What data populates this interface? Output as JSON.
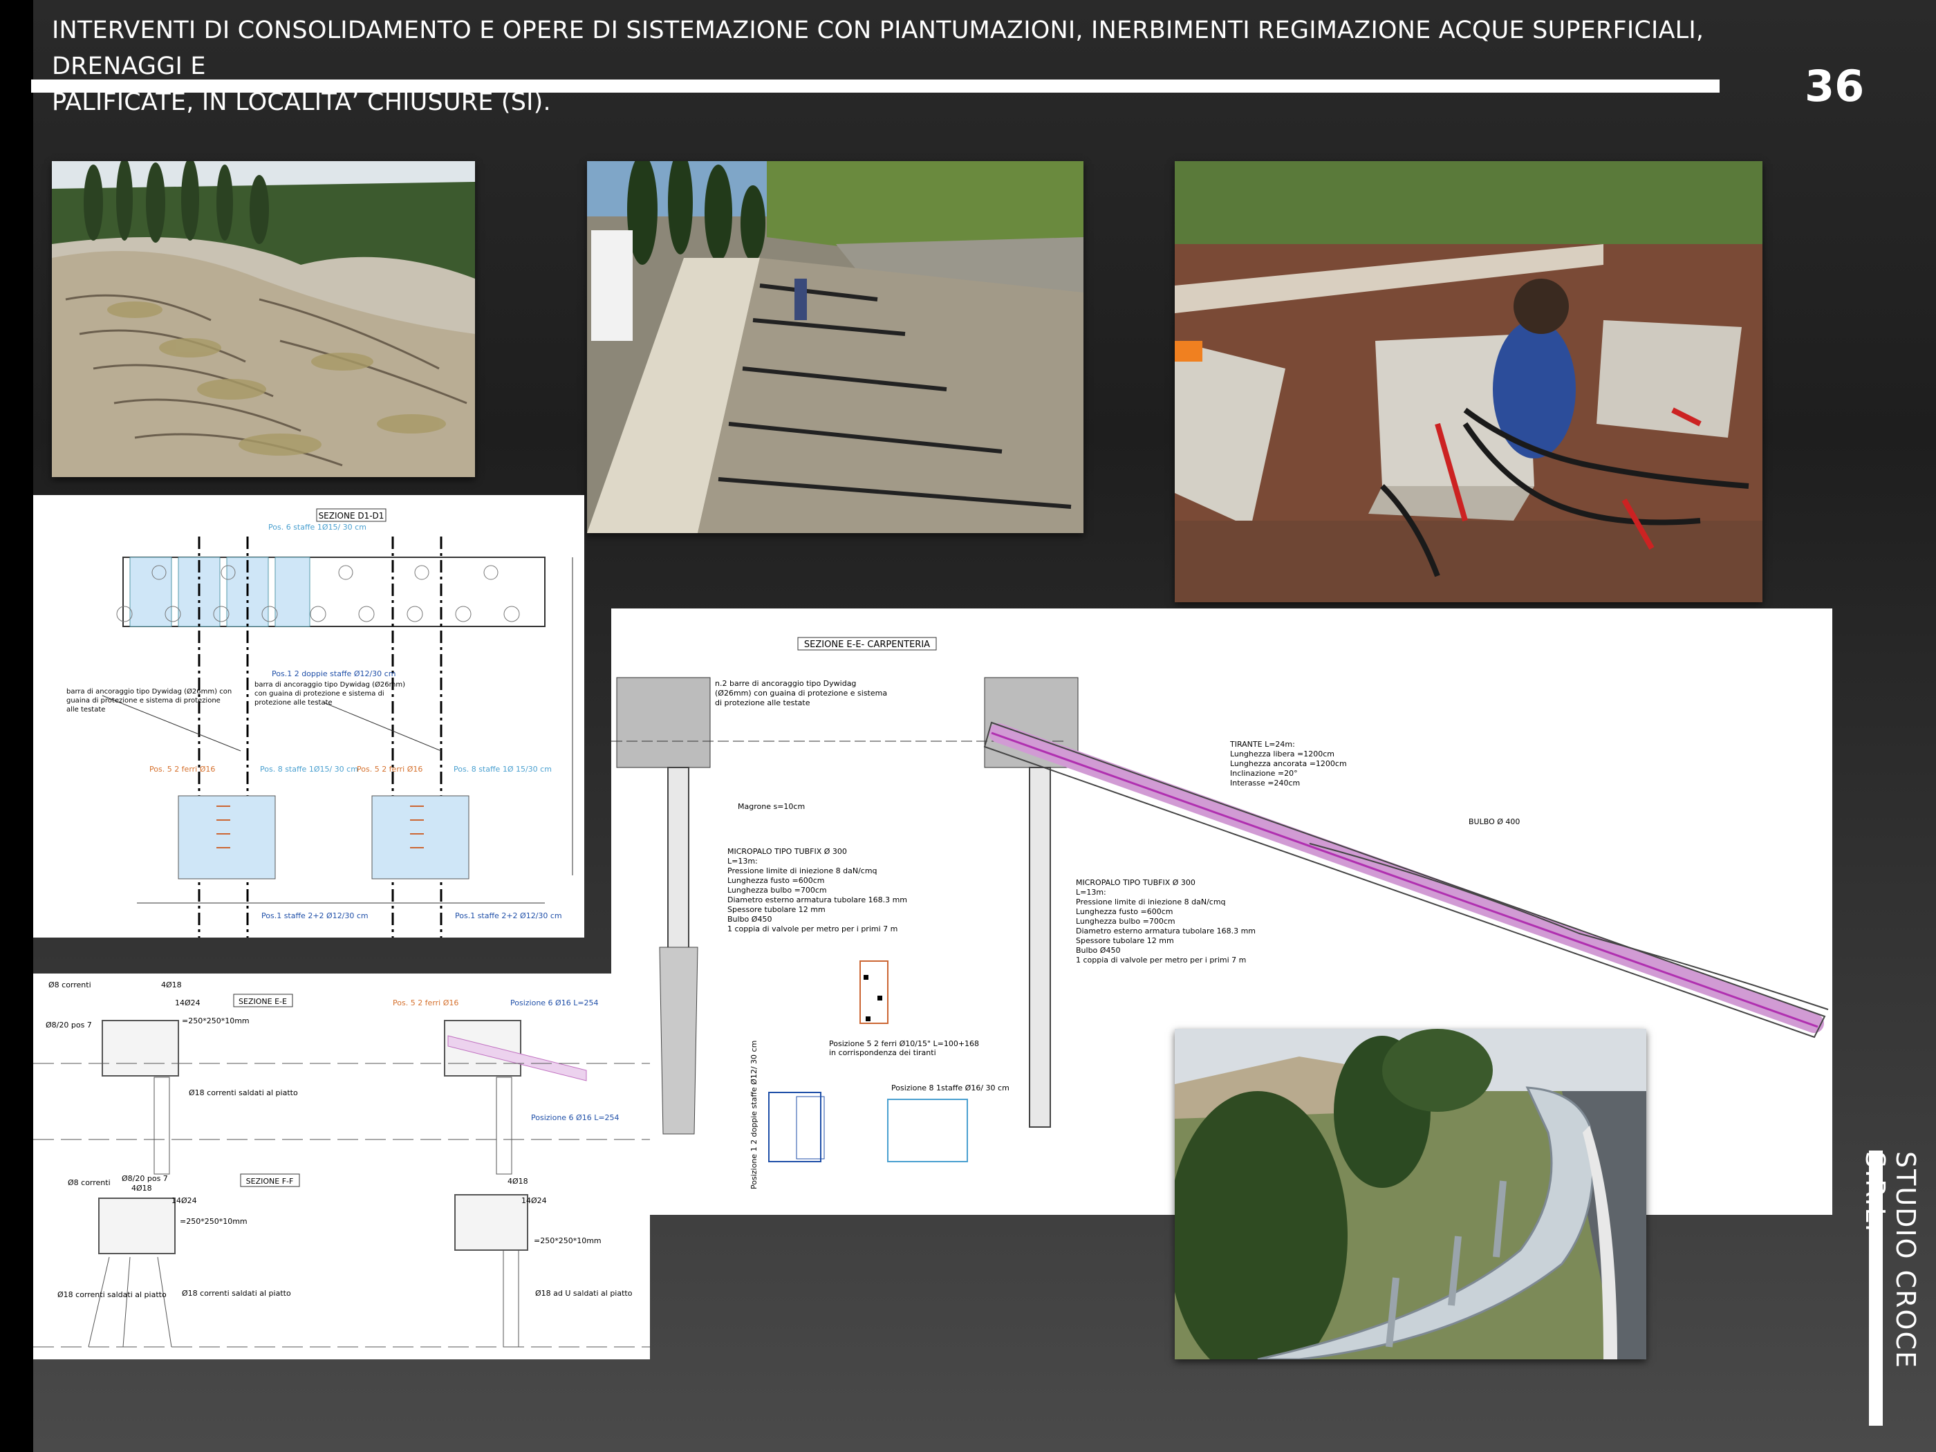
{
  "header": {
    "title_line1": "INTERVENTI DI CONSOLIDAMENTO E OPERE DI SISTEMAZIONE CON PIANTUMAZIONI, INERBIMENTI REGIMAZIONE ACQUE SUPERFICIALI, DRENAGGI E",
    "title_line2": "PALIFICATE, IN LOCALITA’ CHIUSURE (SI).",
    "page_number": "36"
  },
  "brand": "STUDIO CROCE S.R.L.",
  "drawing_d1": {
    "section_title": "SEZIONE D1-D1",
    "pos6": "Pos. 6  staffe 1Ø15/ 30 cm",
    "pos1_double": "Pos.1   2 doppie staffe Ø12/30 cm",
    "bar_left": "barra di ancoraggio tipo Dywidag (Ø26mm) con guaina di protezione e sistema di protezione alle testate",
    "bar_mid": "barra di ancoraggio tipo Dywidag (Ø26mm) con guaina di protezione e sistema di protezione alle testate",
    "pos5_left": "Pos. 5   2 ferri Ø16",
    "pos8_left": "Pos. 8  staffe 1Ø15/ 30 cm",
    "pos5_right": "Pos. 5   2 ferri Ø16",
    "pos8_right": "Pos. 8  staffe 1Ø 15/30 cm",
    "pos1_left": "Pos.1   staffe 2+2 Ø12/30 cm",
    "pos1_right": "Pos.1   staffe 2+2 Ø12/30 cm"
  },
  "drawing_e": {
    "section_title": "SEZIONE E-E- CARPENTERIA",
    "bar_note": "n.2 barre di ancoraggio tipo Dywidag (Ø26mm) con guaina di protezione e sistema di protezione alle testate",
    "magrone": "Magrone s=10cm",
    "tirante": [
      "TIRANTE L=24m:",
      "Lunghezza libera =1200cm",
      "Lunghezza ancorata =1200cm",
      "Inclinazione =20°",
      "Interasse =240cm"
    ],
    "bulbo": "BULBO Ø 400",
    "micropalo_left": [
      "MICROPALO TIPO TUBFIX Ø 300",
      "L=13m:",
      "Pressione limite di iniezione 8 daN/cmq",
      "Lunghezza fusto =600cm",
      "Lunghezza bulbo =700cm",
      "Diametro esterno armatura tubolare 168.3 mm",
      "Spessore tubolare 12 mm",
      "Bulbo Ø450",
      "1 coppia di valvole per metro per i primi 7 m"
    ],
    "micropalo_right": [
      "MICROPALO TIPO TUBFIX Ø 300",
      "L=13m:",
      "Pressione limite di iniezione 8 daN/cmq",
      "Lunghezza fusto =600cm",
      "Lunghezza bulbo =700cm",
      "Diametro esterno armatura tubolare 168.3 mm",
      "Spessore tubolare 12 mm",
      "Bulbo Ø450",
      "1 coppia di valvole per metro per i primi 7 m"
    ],
    "pos5_note": "Posizione 5     2 ferri  Ø10/15\"  L=100+168",
    "pos5_note2": "in corrispondenza dei tiranti",
    "pos8_note": "Posizione 8   1staffe Ø16/ 30 cm",
    "pos1_vertical": "Posizione 1   2 doppie staffe  Ø12/ 30 cm"
  },
  "drawing_ef": {
    "ee_title": "SEZIONE E-E",
    "ff_title": "SEZIONE F-F",
    "ee_correnti": "Ø8 correnti",
    "ee_4018": "4Ø18",
    "ee_14024": "14Ø24",
    "ee_pos7": "Ø8/20 pos 7",
    "ee_plate": "=250*250*10mm",
    "ee_saldati": "Ø18 correnti saldati al piatto",
    "ee_pos5": "Pos. 5  2 ferri Ø16",
    "ee_pos6": "Posizione 6     Ø16  L=254",
    "ee_pos6b": "Posizione 6   Ø16  L=254",
    "ff_correnti": "Ø8 correnti",
    "ff_pos7": "Ø8/20 pos 7",
    "ff_4018": "4Ø18",
    "ff_14024": "14Ø24",
    "ff_plate": "=250*250*10mm",
    "ff_saldati_a": "Ø18 correnti saldati al piatto",
    "ff_saldati_b": "Ø18 correnti saldati al piatto",
    "ff_4018_r": "4Ø18",
    "ff_14024_r": "14Ø24",
    "ff_plate_r": "=250*250*10mm",
    "ff_u": "Ø18 ad U saldati al piatto"
  }
}
